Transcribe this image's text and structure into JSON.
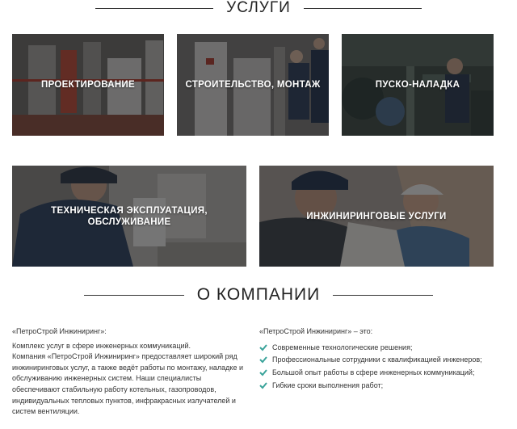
{
  "services_section": {
    "title": "УСЛУГИ",
    "tiles": [
      {
        "label": "ПРОЕКТИРОВАНИЕ"
      },
      {
        "label": "СТРОИТЕЛЬСТВО, МОНТАЖ"
      },
      {
        "label": "ПУСКО-НАЛАДКА"
      },
      {
        "label": "ТЕХНИЧЕСКАЯ ЭКСПЛУАТАЦИЯ, ОБСЛУЖИВАНИЕ"
      },
      {
        "label": "ИНЖИНИРИНГОВЫЕ УСЛУГИ"
      }
    ]
  },
  "about_section": {
    "title": "О КОМПАНИИ",
    "left": {
      "heading": "«ПетроСтрой Инжиниринг»:",
      "paragraph_1": "Комплекс услуг в сфере инженерных коммуникаций.",
      "paragraph_2": "Компания «ПетроСтрой Инжиниринг» предоставляет широкий ряд инжиниринговых услуг, а также ведёт работы по монтажу, наладке и обслуживанию инженерных систем. Наши специалисты обеспечивают стабильную работу котельных, газопроводов, индивидуальных тепловых пунктов, инфракрасных излучателей и систем вентиляции."
    },
    "right": {
      "heading": "«ПетроСтрой Инжиниринг» – это:",
      "items": [
        "Современные технологические решения;",
        "Профессиональные сотрудники с квалификацией инженеров;",
        "Большой опыт работы в сфере инженерных коммуникаций;",
        "Гибкие сроки выполнения работ;"
      ]
    }
  },
  "colors": {
    "check": "#3aa39a",
    "heading_line": "#333333",
    "tile_overlay": "#141416"
  }
}
